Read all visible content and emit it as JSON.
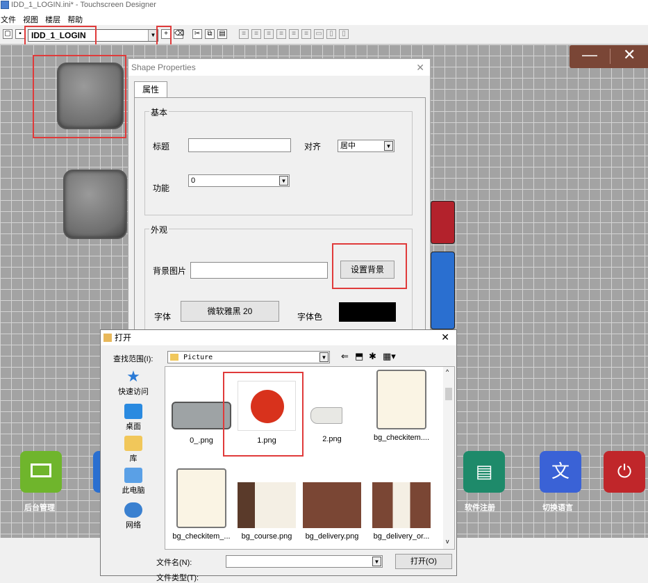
{
  "window": {
    "title": "IDD_1_LOGIN.ini* - Touchscreen Designer"
  },
  "menu": [
    "文件",
    "视图",
    "楼层",
    "帮助"
  ],
  "toolbar": {
    "page_select_value": "IDD_1_LOGIN"
  },
  "canvas_tiles": [
    {
      "label": "后台管理",
      "color": "#6fb52c",
      "icon": "monitor-icon"
    },
    {
      "label": "软件注册",
      "color": "#1e8a6a",
      "icon": "id-card-icon"
    },
    {
      "label": "切换语言",
      "color": "#3a62d6",
      "icon": "translate-icon"
    },
    {
      "label": "",
      "color": "#c0262a",
      "icon": "power-icon"
    }
  ],
  "shape_props": {
    "title": "Shape Properties",
    "tab": "属性",
    "basic_group": "基本",
    "title_label": "标题",
    "title_value": "",
    "align_label": "对齐",
    "align_value": "居中",
    "function_label": "功能",
    "function_value": "0",
    "look_group": "外观",
    "bg_image_label": "背景图片",
    "bg_image_value": "",
    "set_bg_button": "设置背景",
    "font_label": "字体",
    "font_value": "微软雅黑 20",
    "font_color_label": "字体色",
    "font_color": "#000000"
  },
  "open_dialog": {
    "title": "打开",
    "look_in_label": "查找范围(I):",
    "look_in_value": "Picture",
    "places": [
      "快速访问",
      "桌面",
      "库",
      "此电脑",
      "网络"
    ],
    "files": [
      "0_.png",
      "1.png",
      "2.png",
      "bg_checkitem....",
      "bg_checkitem_...",
      "bg_course.png",
      "bg_delivery.png",
      "bg_delivery_or..."
    ],
    "filename_label": "文件名(N):",
    "filename_value": "",
    "open_button": "打开(O)",
    "filetype_label": "文件类型(T):"
  }
}
